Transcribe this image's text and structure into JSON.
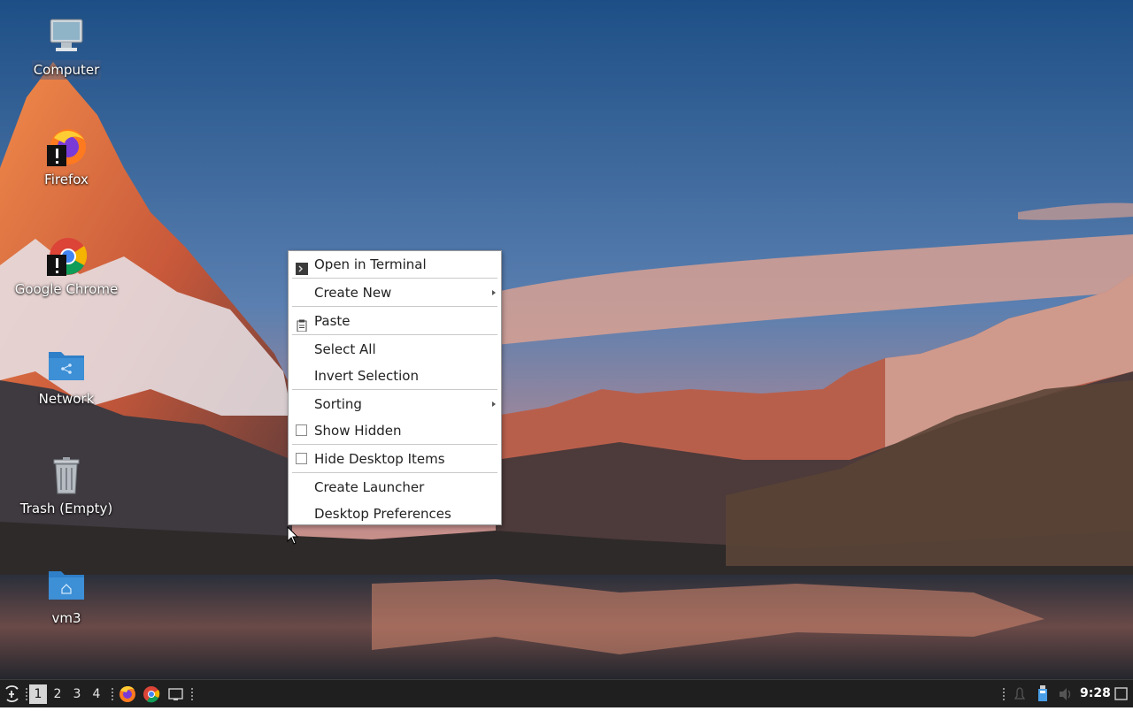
{
  "desktop": {
    "wallpaper": "mountain-lake-sunset",
    "icons": [
      {
        "label": "Computer",
        "icon": "computer-icon"
      },
      {
        "label": "Firefox",
        "icon": "firefox-icon"
      },
      {
        "label": "Google Chrome",
        "icon": "chrome-icon"
      },
      {
        "label": "Network",
        "icon": "network-folder-icon"
      },
      {
        "label": "Trash (Empty)",
        "icon": "trash-icon"
      },
      {
        "label": "vm3",
        "icon": "home-folder-icon"
      }
    ]
  },
  "context_menu": {
    "items": [
      {
        "label": "Open in Terminal",
        "icon": "terminal-icon"
      },
      {
        "label": "Create New",
        "submenu": true
      },
      {
        "label": "Paste",
        "icon": "clipboard-icon"
      },
      {
        "label": "Select All"
      },
      {
        "label": "Invert Selection"
      },
      {
        "label": "Sorting",
        "submenu": true
      },
      {
        "label": "Show Hidden",
        "checkbox": true,
        "checked": false
      },
      {
        "label": "Hide Desktop Items",
        "checkbox": true,
        "checked": false
      },
      {
        "label": "Create Launcher"
      },
      {
        "label": "Desktop Preferences"
      }
    ]
  },
  "taskbar": {
    "start_icon": "distro-menu-icon",
    "workspaces": [
      "1",
      "2",
      "3",
      "4"
    ],
    "active_workspace": "1",
    "launchers": [
      "firefox-icon",
      "chrome-icon",
      "show-desktop-icon"
    ],
    "tray": [
      "notifications-icon",
      "removable-drive-icon",
      "volume-icon"
    ],
    "clock": "9:28"
  },
  "colors": {
    "taskbar_bg": "#1f1f1f",
    "menu_bg": "#ffffff",
    "folder_blue": "#3d8fd6"
  }
}
